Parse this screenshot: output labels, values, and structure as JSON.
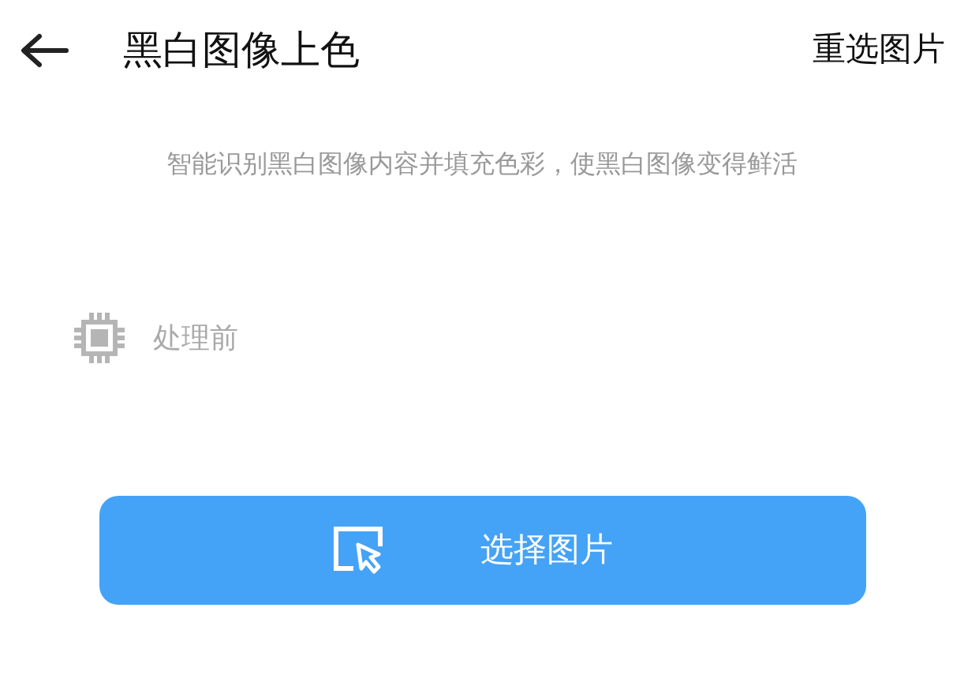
{
  "header": {
    "title": "黑白图像上色",
    "action": "重选图片"
  },
  "description": "智能识别黑白图像内容并填充色彩，使黑白图像变得鲜活",
  "section": {
    "label": "处理前"
  },
  "button": {
    "label": "选择图片"
  }
}
